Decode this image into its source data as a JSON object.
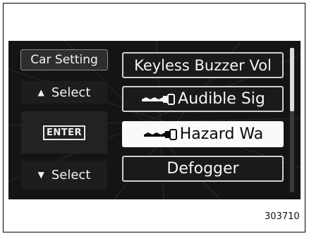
{
  "screen": {
    "left_buttons": {
      "car_setting": "Car Setting",
      "select_up": "Select",
      "enter": "ENTER",
      "select_down": "Select"
    },
    "menu_items": [
      {
        "label": "Keyless Buzzer Vol",
        "icon": "none",
        "selected": false
      },
      {
        "label": "Audible Sig",
        "icon": "key-icon",
        "selected": false
      },
      {
        "label": "Hazard Wa",
        "icon": "key-icon",
        "selected": true
      },
      {
        "label": "Defogger",
        "icon": "none",
        "selected": false
      }
    ],
    "scroll_position_fraction": 0.0
  },
  "figure_ref": "303710"
}
